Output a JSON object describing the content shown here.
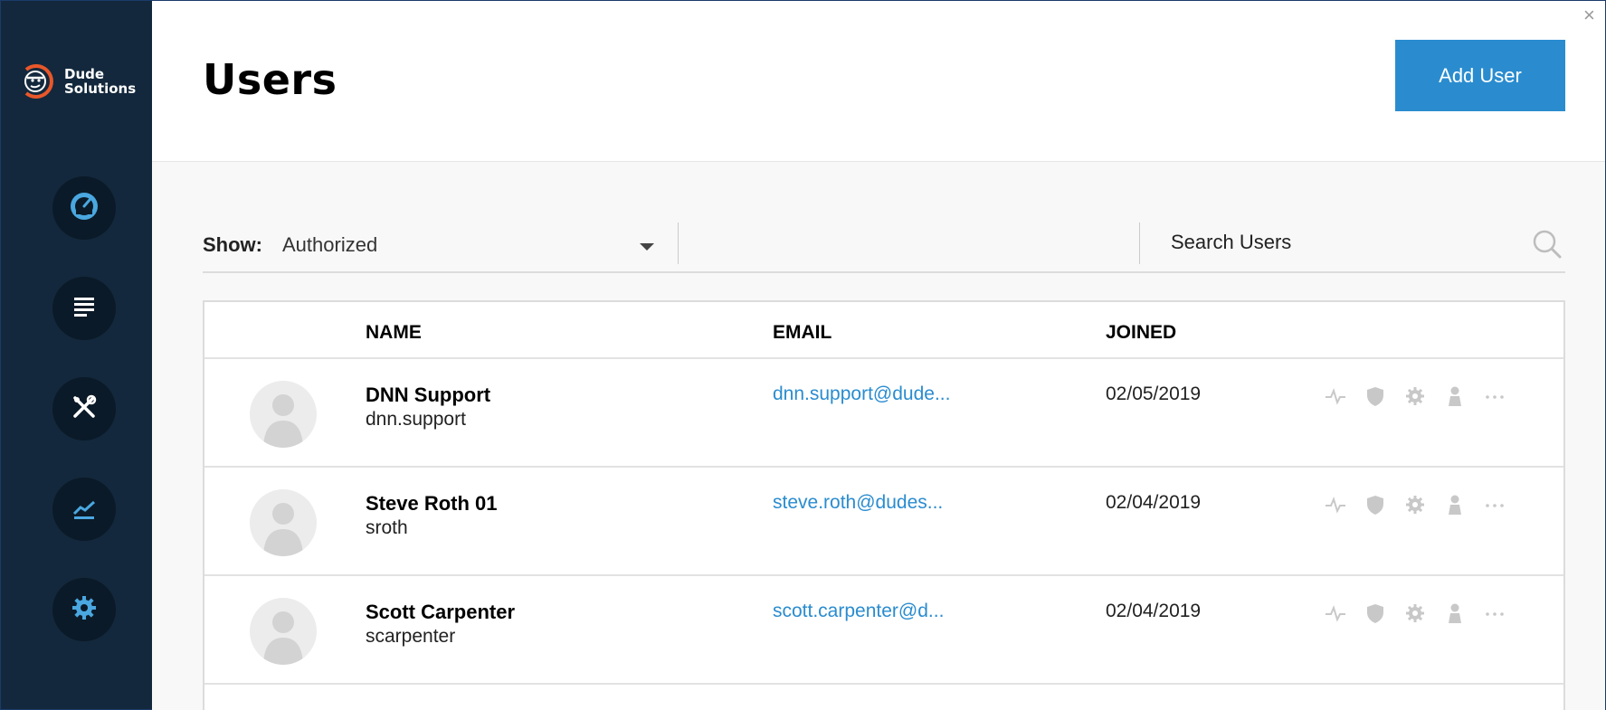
{
  "brand": {
    "line1": "Dude",
    "line2": "Solutions"
  },
  "header": {
    "title": "Users",
    "add_button": "Add User",
    "close_glyph": "×"
  },
  "sidebar": {
    "items": [
      {
        "icon": "dashboard-gauge-icon"
      },
      {
        "icon": "content-list-icon"
      },
      {
        "icon": "tools-icon"
      },
      {
        "icon": "analytics-chart-icon"
      },
      {
        "icon": "settings-gear-icon"
      }
    ]
  },
  "filter": {
    "show_label": "Show:",
    "show_value": "Authorized",
    "search_placeholder": "Search Users"
  },
  "table": {
    "columns": {
      "name": "NAME",
      "email": "EMAIL",
      "joined": "JOINED"
    },
    "rows": [
      {
        "name": "DNN Support",
        "username": "dnn.support",
        "email": "dnn.support@dude...",
        "joined": "02/05/2019"
      },
      {
        "name": "Steve Roth 01",
        "username": "sroth",
        "email": "steve.roth@dudes...",
        "joined": "02/04/2019"
      },
      {
        "name": "Scott Carpenter",
        "username": "scarpenter",
        "email": "scott.carpenter@d...",
        "joined": "02/04/2019"
      }
    ],
    "row_actions": [
      "activity-icon",
      "security-shield-icon",
      "settings-gear-icon",
      "user-profile-icon",
      "more-options-icon"
    ]
  },
  "colors": {
    "sidebar": "#13283c",
    "accent": "#2a8ccf",
    "logo_orange": "#e8572a"
  }
}
